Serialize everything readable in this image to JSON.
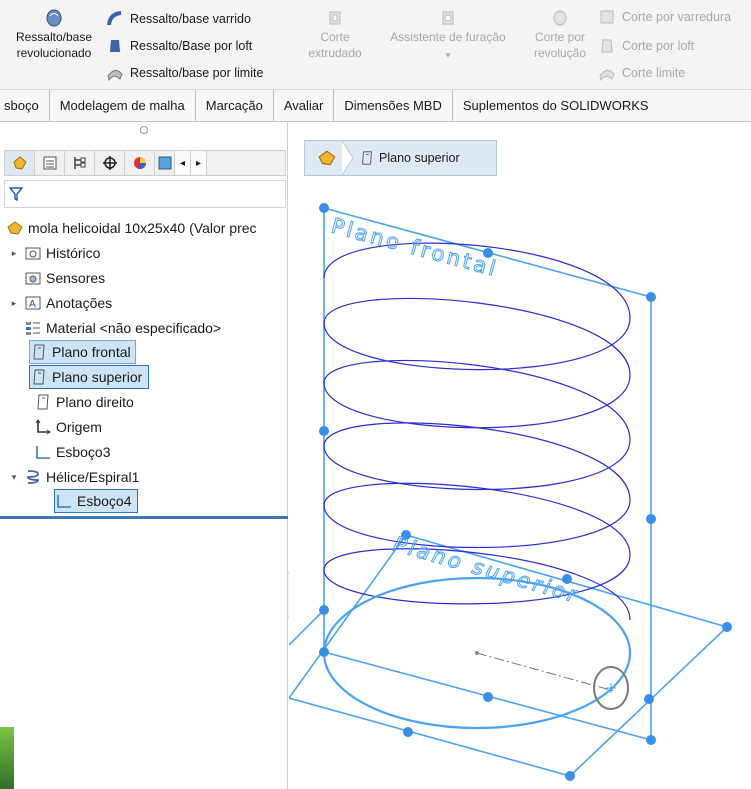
{
  "ribbon": {
    "revolve_boss": "Ressalto/base revolucionado",
    "swept_boss": "Ressalto/base varrido",
    "loft_boss": "Ressalto/Base por loft",
    "boundary_boss": "Ressalto/base por limite",
    "extruded_cut": "Corte extrudado",
    "hole_wizard": "Assistente de furação",
    "revolved_cut": "Corte por revolução",
    "swept_cut": "Corte por varredura",
    "lofted_cut": "Corte por loft",
    "boundary_cut": "Corte limite"
  },
  "tabs": [
    "sboço",
    "Modelagem de malha",
    "Marcação",
    "Avaliar",
    "Dimensões MBD",
    "Suplementos do SOLIDWORKS"
  ],
  "tree": {
    "root": "mola helicoidal 10x25x40 (Valor prec",
    "history": "Histórico",
    "sensors": "Sensores",
    "annotations": "Anotações",
    "material": "Material <não especificado>",
    "front_plane": "Plano frontal",
    "top_plane": "Plano superior",
    "right_plane": "Plano direito",
    "origin": "Origem",
    "sketch3": "Esboço3",
    "helix": "Hélice/Espiral1",
    "sketch4": "Esboço4"
  },
  "breadcrumb": {
    "item": "Plano superior"
  },
  "viewport": {
    "front_plane_label": "Plano frontal",
    "top_plane_label": "Plano superior"
  },
  "colors": {
    "plane_blue": "#4aa3f0",
    "helix_blue": "#2b2bd0",
    "selection": "#cde4f7"
  }
}
